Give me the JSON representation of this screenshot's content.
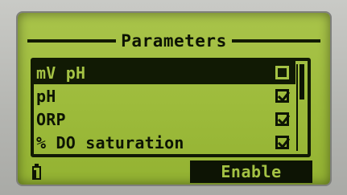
{
  "screen": {
    "title": "Parameters",
    "items": [
      {
        "label": "mV pH",
        "checked": false,
        "selected": true
      },
      {
        "label": "pH",
        "checked": true,
        "selected": false
      },
      {
        "label": "ORP",
        "checked": true,
        "selected": false
      },
      {
        "label": "% DO saturation",
        "checked": true,
        "selected": false
      }
    ],
    "softkey": "Enable",
    "battery_icon": "battery-icon"
  },
  "colors": {
    "lcd_background": "#9dbb3b",
    "lcd_ink": "#0d1404",
    "bezel": "#b9bab7"
  }
}
